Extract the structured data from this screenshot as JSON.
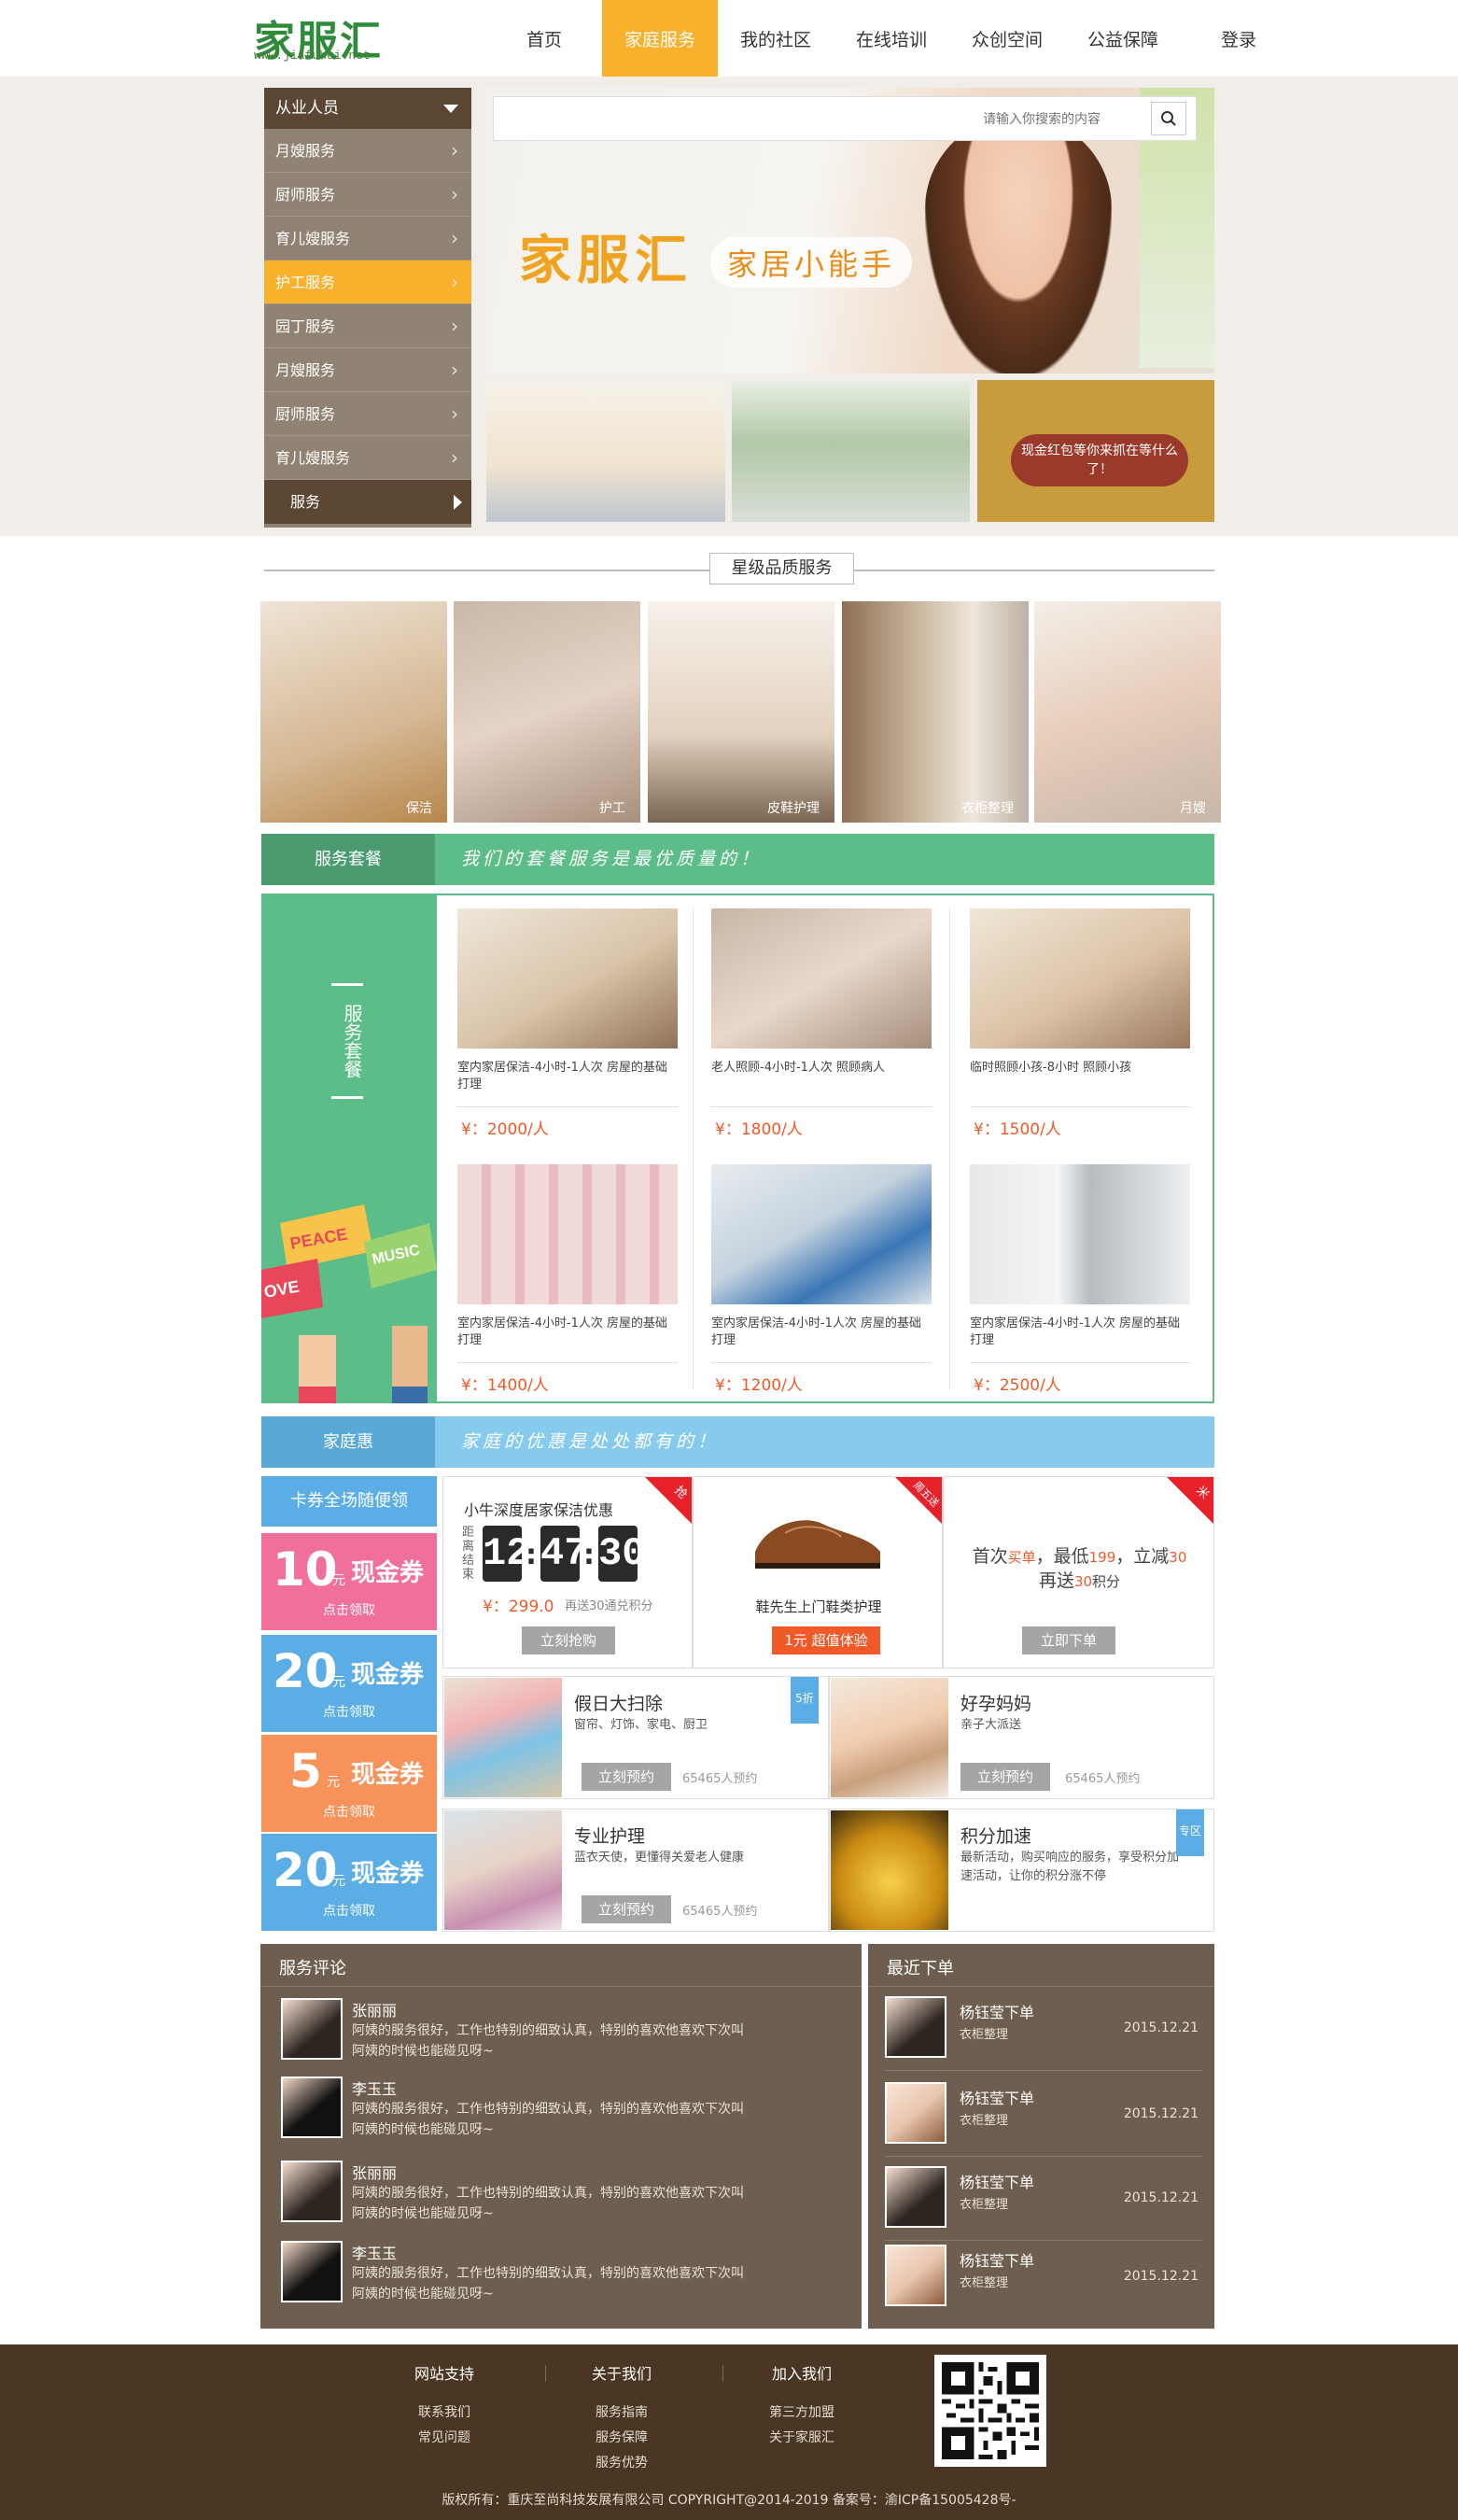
{
  "header": {
    "logo": "家服汇",
    "logo_url": "www.jiafuhui.net",
    "nav": [
      "首页",
      "家庭服务",
      "我的社区",
      "在线培训",
      "众创空间",
      "公益保障",
      "登录"
    ]
  },
  "sidebar": {
    "title": "从业人员",
    "items": [
      "月嫂服务",
      "厨师服务",
      "育儿嫂服务",
      "护工服务",
      "园丁服务",
      "月嫂服务",
      "厨师服务",
      "育儿嫂服务"
    ],
    "footer": "服务"
  },
  "search": {
    "placeholder": "请输入你搜索的内容"
  },
  "hero": {
    "title": "家服汇",
    "subtitle": "家居小能手"
  },
  "thumbs": {
    "third_label": "现金红包等你来抓在等什么了！"
  },
  "star_section": {
    "title": "星级品质服务",
    "items": [
      "保洁",
      "护工",
      "皮鞋护理",
      "衣柜整理",
      "月嫂"
    ]
  },
  "package": {
    "tab": "服务套餐",
    "slogan": "我们的套餐服务是最优质量的！",
    "side_label": "服务套餐",
    "cards": [
      {
        "desc": "室内家居保洁-4小时-1人次 房屋的基础打理",
        "price": "¥：2000/人"
      },
      {
        "desc": "老人照顾-4小时-1人次 照顾病人",
        "price": "¥：1800/人"
      },
      {
        "desc": "临时照顾小孩-8小时 照顾小孩",
        "price": "¥：1500/人"
      },
      {
        "desc": "室内家居保洁-4小时-1人次 房屋的基础打理",
        "price": "¥：1400/人"
      },
      {
        "desc": "室内家居保洁-4小时-1人次 房屋的基础打理",
        "price": "¥：1200/人"
      },
      {
        "desc": "室内家居保洁-4小时-1人次 房屋的基础打理",
        "price": "¥：2500/人"
      }
    ],
    "flags": [
      "PEACE",
      "MUSIC",
      "OVE"
    ]
  },
  "family": {
    "tab": "家庭惠",
    "slogan": "家庭的优惠是处处都有的！",
    "coupon_head": "卡券全场随便领",
    "coupons": [
      {
        "amount": "10",
        "unit": "元",
        "name": "现金券",
        "action": "点击领取",
        "color": "#f0709a"
      },
      {
        "amount": "20",
        "unit": "元",
        "name": "现金券",
        "action": "点击领取",
        "color": "#5aaee5"
      },
      {
        "amount": "5",
        "unit": "元",
        "name": "现金券",
        "action": "点击领取",
        "color": "#f7925a"
      },
      {
        "amount": "20",
        "unit": "元",
        "name": "现金券",
        "action": "点击领取",
        "color": "#5aaee5"
      }
    ],
    "deal1": {
      "title": "小牛深度居家保洁优惠",
      "side": "距离结束",
      "digits": [
        "12",
        "47",
        "30"
      ],
      "price": "¥：299.0",
      "note": "再送30通兑积分",
      "button": "立刻抢购",
      "corner": "抢"
    },
    "deal2": {
      "title": "鞋先生上门鞋类护理",
      "button": "1元 超值体验",
      "corner": "周五送"
    },
    "deal3": {
      "line1a": "首次",
      "line1b": "买单",
      "line1c": "，最低",
      "line1d": "199",
      "line1e": "，立减",
      "line1f": "30",
      "line2a": "再送",
      "line2b": "30",
      "line2c": "积分",
      "button": "立即下单",
      "corner": "米"
    },
    "tiles": [
      {
        "title": "假日大扫除",
        "sub": "窗帘、灯饰、家电、厨卫",
        "button": "立刻预约",
        "count": "65465人预约",
        "ribbon": "5折"
      },
      {
        "title": "好孕妈妈",
        "sub": "亲子大派送",
        "button": "立刻预约",
        "count": "65465人预约"
      },
      {
        "title": "专业护理",
        "sub": "蓝衣天使，更懂得关爱老人健康",
        "button": "立刻预约",
        "count": "65465人预约"
      },
      {
        "title": "积分加速",
        "sub": "最新活动，购买响应的服务，享受积分加速活动，让你的积分涨不停",
        "ribbon": "专区"
      }
    ]
  },
  "reviews": {
    "title": "服务评论",
    "items": [
      {
        "name": "张丽丽",
        "text": "阿姨的服务很好，工作也特别的细致认真，特别的喜欢他喜欢下次叫阿姨的时候也能碰见呀~"
      },
      {
        "name": "李玉玉",
        "text": "阿姨的服务很好，工作也特别的细致认真，特别的喜欢他喜欢下次叫阿姨的时候也能碰见呀~"
      },
      {
        "name": "张丽丽",
        "text": "阿姨的服务很好，工作也特别的细致认真，特别的喜欢他喜欢下次叫阿姨的时候也能碰见呀~"
      },
      {
        "name": "李玉玉",
        "text": "阿姨的服务很好，工作也特别的细致认真，特别的喜欢他喜欢下次叫阿姨的时候也能碰见呀~"
      }
    ]
  },
  "recent": {
    "title": "最近下单",
    "items": [
      {
        "name": "杨钰莹下单",
        "sub": "衣柜整理",
        "date": "2015.12.21"
      },
      {
        "name": "杨钰莹下单",
        "sub": "衣柜整理",
        "date": "2015.12.21"
      },
      {
        "name": "杨钰莹下单",
        "sub": "衣柜整理",
        "date": "2015.12.21"
      },
      {
        "name": "杨钰莹下单",
        "sub": "衣柜整理",
        "date": "2015.12.21"
      }
    ]
  },
  "footer": {
    "cols": [
      {
        "head": "网站支持",
        "links": [
          "联系我们",
          "常见问题"
        ]
      },
      {
        "head": "关于我们",
        "links": [
          "服务指南",
          "服务保障",
          "服务优势"
        ]
      },
      {
        "head": "加入我们",
        "links": [
          "第三方加盟",
          "关于家服汇"
        ]
      }
    ],
    "copyright": "版权所有：重庆至尚科技发展有限公司 COPYRIGHT@2014-2019 备案号：渝ICP备15005428号-"
  }
}
